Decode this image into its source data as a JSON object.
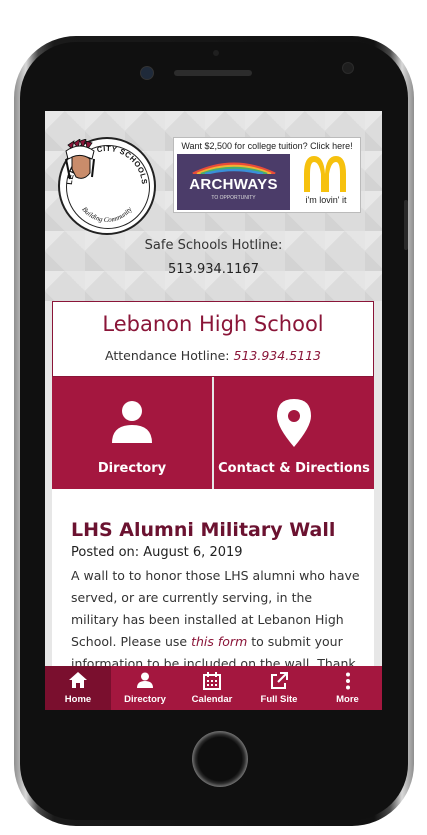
{
  "hero": {
    "logo_text_top": "LEBANON CITY SCHOOLS",
    "logo_text_bottom": "Building Community",
    "ad": {
      "headline": "Want $2,500 for college tuition? Click here!",
      "brand": "ARCHWAYS",
      "brand_sub": "TO OPPORTUNITY",
      "slogan": "i'm lovin' it"
    },
    "hotline_label": "Safe Schools Hotline:",
    "hotline_number": "513.934.1167"
  },
  "school": {
    "name": "Lebanon High School",
    "attendance_label": "Attendance Hotline:",
    "attendance_number": "513.934.5113"
  },
  "tiles": [
    {
      "label": "Directory",
      "icon": "person-icon"
    },
    {
      "label": "Contact & Directions",
      "icon": "map-pin-icon"
    }
  ],
  "article": {
    "title": "LHS Alumni Military Wall",
    "date": "Posted on: August 6, 2019",
    "body_1": "A wall to to honor those LHS alumni who have served, or are currently serving, in the military has been installed at Lebanon High School. Please use ",
    "link": "this form",
    "body_2": " to submit your information to be included on the wall. Thank"
  },
  "tabbar": [
    {
      "label": "Home",
      "icon": "home-icon",
      "active": true
    },
    {
      "label": "Directory",
      "icon": "person-icon",
      "active": false
    },
    {
      "label": "Calendar",
      "icon": "calendar-icon",
      "active": false
    },
    {
      "label": "Full Site",
      "icon": "external-link-icon",
      "active": false
    },
    {
      "label": "More",
      "icon": "more-vertical-icon",
      "active": false
    }
  ],
  "colors": {
    "brand": "#a4173f",
    "brand_dark": "#7a0f2e",
    "title": "#8a1538"
  }
}
